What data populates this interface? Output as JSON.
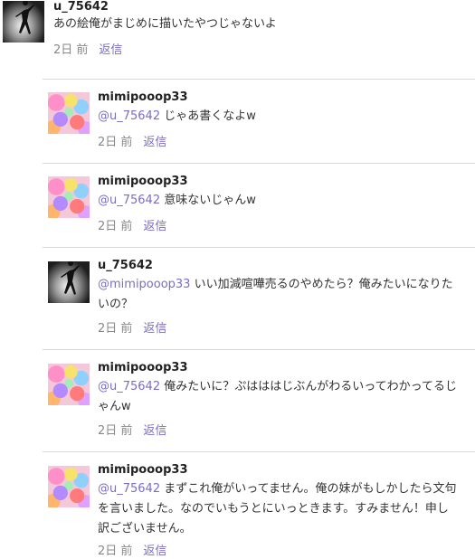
{
  "comments": [
    {
      "username": "u_75642",
      "mention": "",
      "text": "あの絵俺がまじめに描いたやつじゃないよ",
      "time": "2日 前",
      "reply_label": "返信",
      "avatar": "silhouette-figure"
    },
    {
      "username": "mimipooop33",
      "mention": "@u_75642",
      "text": " じゃあ書くなよw",
      "time": "2日 前",
      "reply_label": "返信",
      "avatar": "colorful-crowd"
    },
    {
      "username": "mimipooop33",
      "mention": "@u_75642",
      "text": " 意味ないじゃんw",
      "time": "2日 前",
      "reply_label": "返信",
      "avatar": "colorful-crowd"
    },
    {
      "username": "u_75642",
      "mention": "@mimipooop33",
      "text": " いい加減喧嘩売るのやめたら？俺みたいになりたいの？",
      "time": "2日 前",
      "reply_label": "返信",
      "avatar": "silhouette-figure"
    },
    {
      "username": "mimipooop33",
      "mention": "@u_75642",
      "text": " 俺みたいに？ぷはははじぶんがわるいってわかってるじゃんw",
      "time": "2日 前",
      "reply_label": "返信",
      "avatar": "colorful-crowd"
    },
    {
      "username": "mimipooop33",
      "mention": "@u_75642",
      "text": " まずこれ俺がいってません。俺の妹がもしかしたら文句を言いました。なのでいもうとにいっときます。すみません！申し訳ございません。",
      "time": "2日 前",
      "reply_label": "返信",
      "avatar": "colorful-crowd"
    }
  ],
  "colors": {
    "accent": "#7b6cc8",
    "time": "#888888",
    "divider": "#d8d8d8"
  }
}
